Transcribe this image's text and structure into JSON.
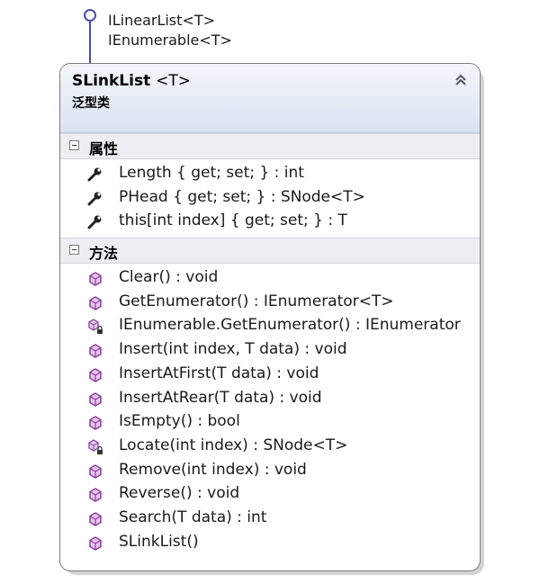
{
  "interfaces": [
    "ILinearList<T>",
    "IEnumerable<T>"
  ],
  "class_box": {
    "name": "SLinkList",
    "generic": "<T>",
    "kind": "泛型类"
  },
  "sections": {
    "properties": {
      "title": "属性",
      "members": [
        {
          "text": "Length { get; set; } : int",
          "icon": "wrench-icon"
        },
        {
          "text": "PHead { get; set; } : SNode<T>",
          "icon": "wrench-icon"
        },
        {
          "text": "this[int index] { get; set; } : T",
          "icon": "wrench-icon"
        }
      ]
    },
    "methods": {
      "title": "方法",
      "members": [
        {
          "text": "Clear() : void",
          "icon": "method-icon"
        },
        {
          "text": "GetEnumerator() : IEnumerator<T>",
          "icon": "method-icon"
        },
        {
          "text": "IEnumerable.GetEnumerator() : IEnumerator",
          "icon": "private-method-icon"
        },
        {
          "text": "Insert(int index, T data) : void",
          "icon": "method-icon"
        },
        {
          "text": "InsertAtFirst(T data) : void",
          "icon": "method-icon"
        },
        {
          "text": "InsertAtRear(T data) : void",
          "icon": "method-icon"
        },
        {
          "text": "IsEmpty() : bool",
          "icon": "method-icon"
        },
        {
          "text": "Locate(int index) : SNode<T>",
          "icon": "private-method-icon"
        },
        {
          "text": "Remove(int index) : void",
          "icon": "method-icon"
        },
        {
          "text": "Reverse() : void",
          "icon": "method-icon"
        },
        {
          "text": "Search(T data) : int",
          "icon": "method-icon"
        },
        {
          "text": "SLinkList()",
          "icon": "method-icon"
        }
      ]
    }
  },
  "colors": {
    "interface_lollipop": "#4a4fa8",
    "method_icon": "#8a3f9e",
    "header_gradient_top": "#f3f6fb",
    "header_gradient_bottom": "#dbe3f0"
  }
}
